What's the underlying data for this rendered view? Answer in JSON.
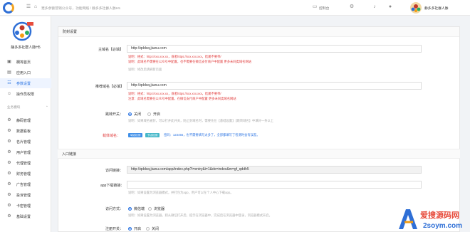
{
  "topbar": {
    "breadcrumb": "更多余额营销公众号，功能网络 / 静多多社群人脉H5",
    "control_label": "控制台",
    "avatar_name": "静多多社群人脉",
    "icons": [
      "menu-icon",
      "home-icon",
      "monitor-icon",
      "gear-icon",
      "bell-icon",
      "user-icon"
    ]
  },
  "sidebar": {
    "brand_name": "静多多社群人脉H5",
    "top_items": [
      {
        "label": "欄埠首页",
        "icon": "home-icon"
      },
      {
        "label": "应用入口",
        "icon": "app-icon"
      },
      {
        "label": "参数设置",
        "icon": "settings-icon",
        "active": true
      },
      {
        "label": "操作员权限",
        "icon": "user-key-icon"
      }
    ],
    "section_title": "业务模块",
    "module_items": [
      {
        "label": "静码管理"
      },
      {
        "label": "数据看板"
      },
      {
        "label": "名片管理"
      },
      {
        "label": "用户管理"
      },
      {
        "label": "代理管理"
      },
      {
        "label": "财务管理"
      },
      {
        "label": "广告管理"
      },
      {
        "label": "投诉管理"
      },
      {
        "label": "卡密管理"
      },
      {
        "label": "基础设置"
      }
    ]
  },
  "main": {
    "section1_title": "防封设置",
    "main_domain": {
      "label": "主域名【必填】",
      "value": "http://qddsq.jiuwu.com",
      "note1": "说明：格式：http://xxx.xxx.xx，或者https://xxx.xxx.xxx，结尾不要带/",
      "note2": "说明：此域名不需要在公众号中配置，也不需要在微信支付商户中配置 更多未同类域名网站",
      "note3": "说明：修改后请刷新页面"
    },
    "landing_domain": {
      "label": "推荐域名【必填】",
      "value": "http://qddsq.jiuwu.com",
      "note1": "说明：格式：http://xxx.xxx.xx，或者https://xxx.xxx.xxx，结尾不要带/",
      "note2": "注意：此域名需要在公众号中配置，在微信支付商户中配置 更多未同类域名网站"
    },
    "jump_switch": {
      "label": "跳转开关：",
      "options": [
        "关闭",
        "开启"
      ],
      "selected": "关闭",
      "note": "说明：如果域名被封，可以打开此开关，防止封域名时，需要先在【基础设置】【跳转域名】中填好一条以上"
    },
    "loading_hint": {
      "label": "载体域名：",
      "btn1": "域名检测",
      "btn2": "节点检测",
      "text": "密码：123456，也不需要填写太多了，全部都填写了检测时会有误差。"
    },
    "section2_title": "入口链接",
    "access_link": {
      "label": "访问链接：",
      "value": "http://qddsq.jiuwu.com/app/index.php?i=entry&i=1&do=index&m=gf_qddh5"
    },
    "app_download": {
      "label": "app下载链接：",
      "value": "",
      "note": "说明：如果设置为浏览器模式，并打包为app，用户可以在个人中心下载app。"
    },
    "access_mode": {
      "label": "访问方式：",
      "options": [
        "微信端",
        "浏览器"
      ],
      "selected": "微信端",
      "note": "说明：如果设置为浏览器，则从微信打开后，提示在浏览器中，完成后在浏览器中登录，浏览器模式开启。"
    },
    "register_switch": {
      "label": "注册开关：",
      "options": [
        "开启",
        "关闭"
      ],
      "selected": "开启"
    }
  },
  "watermark": {
    "line1": "爱搜源码网",
    "line2": "2soym.com"
  },
  "colors": {
    "accent": "#2b74e2",
    "danger": "#e03b3b",
    "btn_blue": "#3f8fe8",
    "btn_green": "#46b8c9"
  }
}
